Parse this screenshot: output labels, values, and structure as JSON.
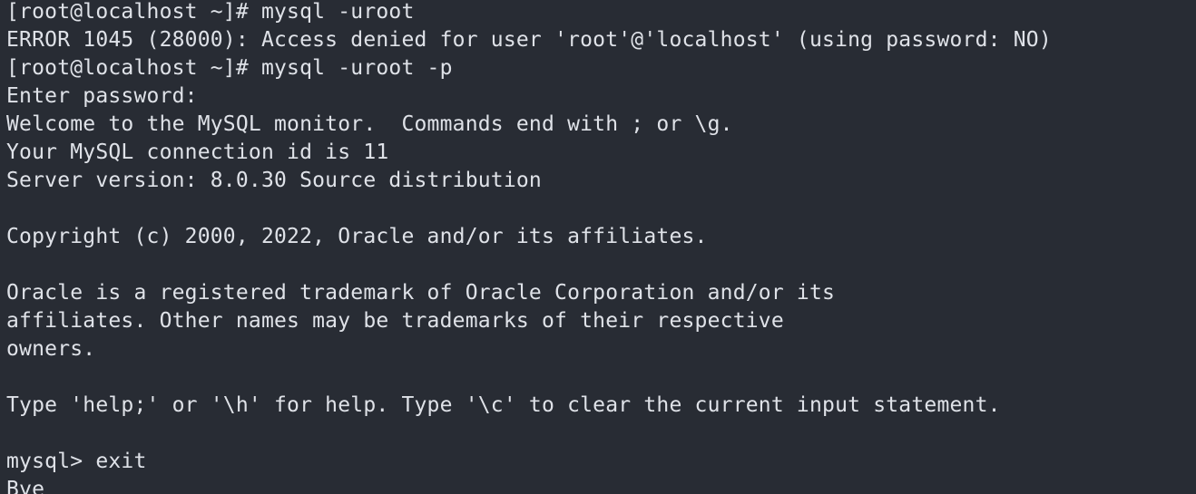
{
  "terminal": {
    "lines": [
      "[root@localhost ~]# mysql -uroot",
      "ERROR 1045 (28000): Access denied for user 'root'@'localhost' (using password: NO)",
      "[root@localhost ~]# mysql -uroot -p",
      "Enter password:",
      "Welcome to the MySQL monitor.  Commands end with ; or \\g.",
      "Your MySQL connection id is 11",
      "Server version: 8.0.30 Source distribution",
      "",
      "Copyright (c) 2000, 2022, Oracle and/or its affiliates.",
      "",
      "Oracle is a registered trademark of Oracle Corporation and/or its",
      "affiliates. Other names may be trademarks of their respective",
      "owners.",
      "",
      "Type 'help;' or '\\h' for help. Type '\\c' to clear the current input statement.",
      "",
      "mysql> exit",
      "Bye"
    ]
  }
}
